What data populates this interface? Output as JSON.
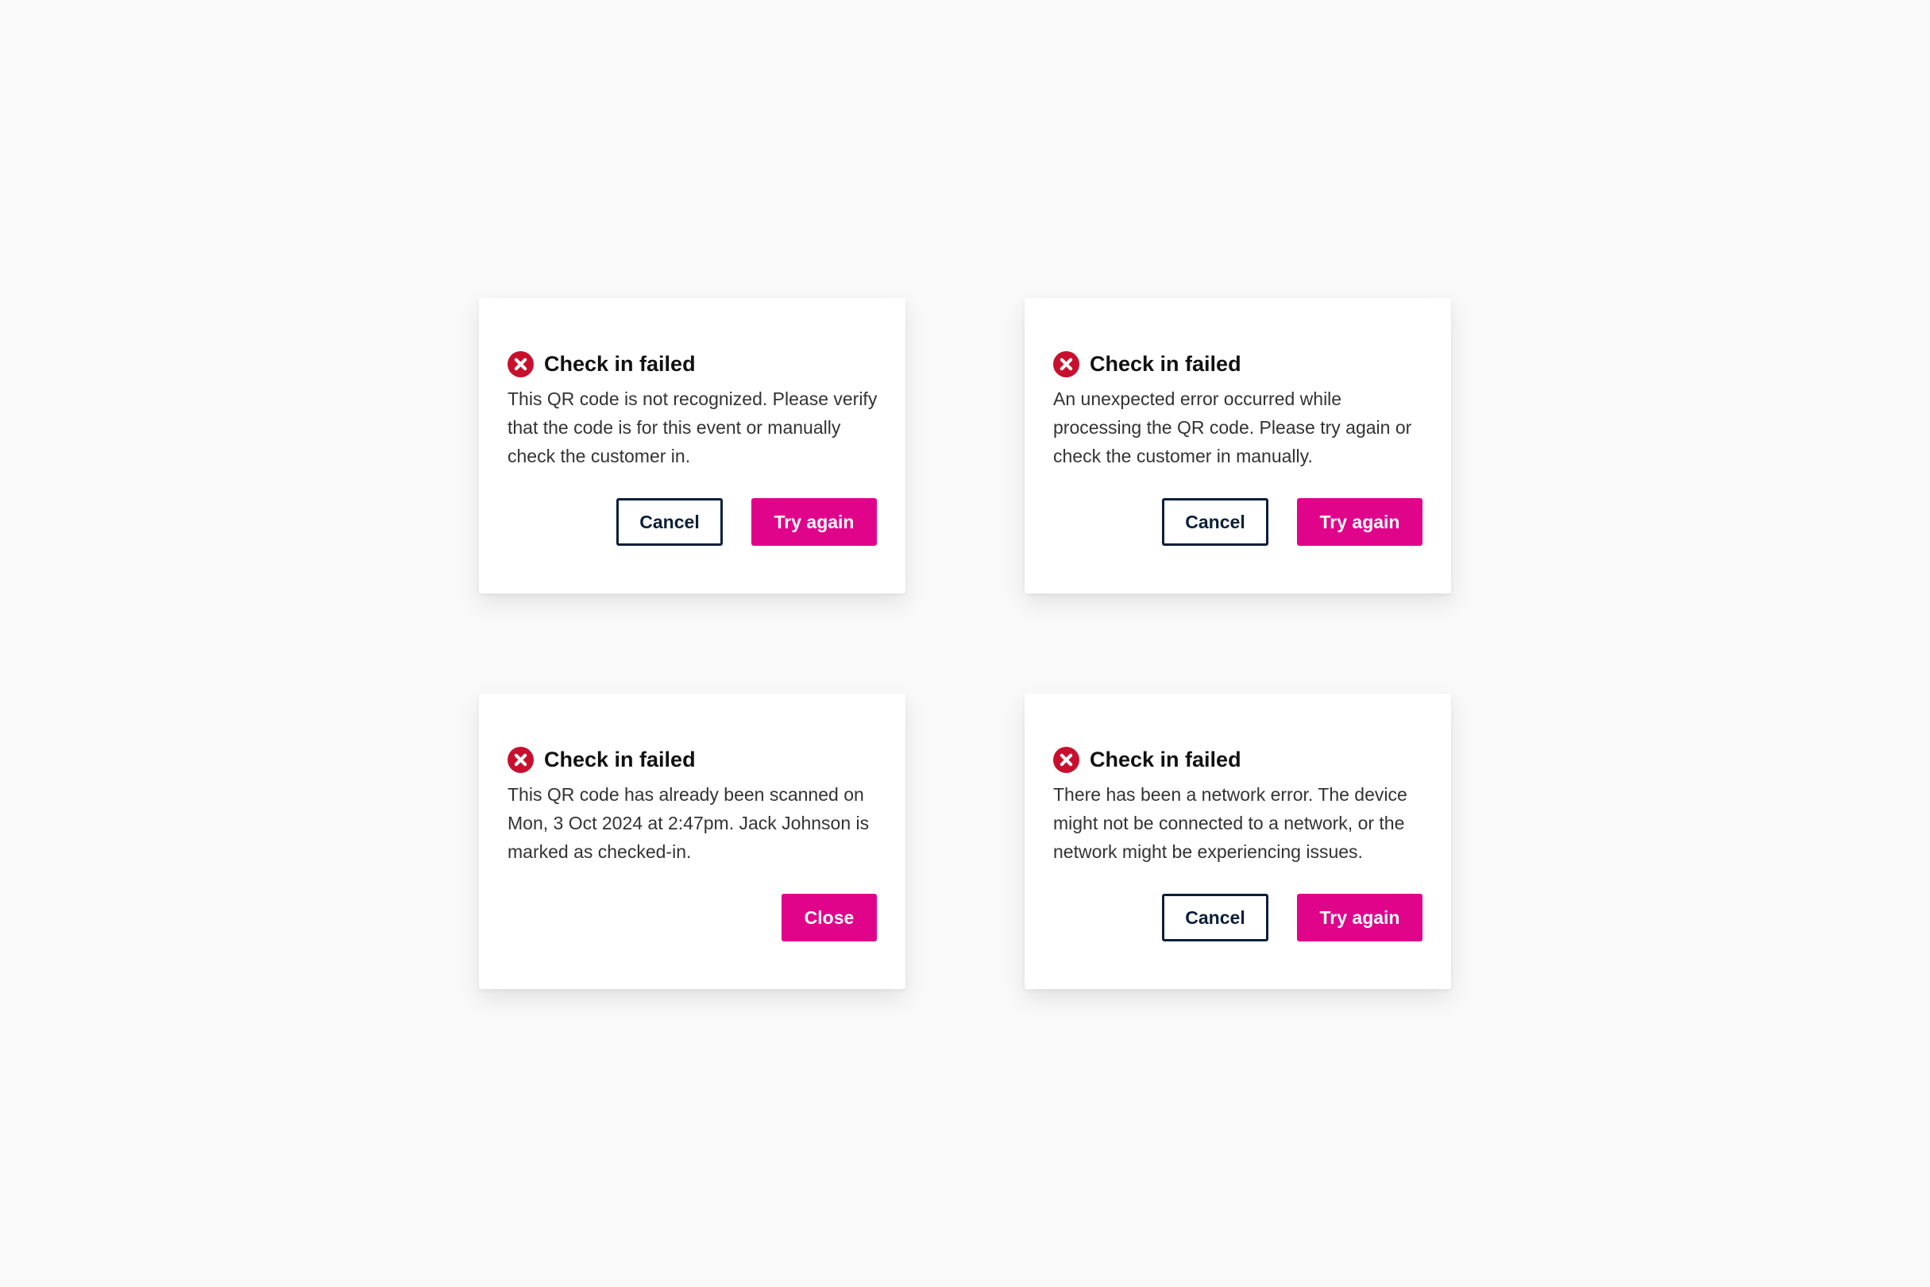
{
  "colors": {
    "background": "#f9f9f9",
    "error_icon": "#c8102e",
    "primary_button": "#e0048b",
    "secondary_border": "#0b1f3a"
  },
  "dialogs": [
    {
      "icon": "error-circle-x-icon",
      "title": "Check in failed",
      "message": "This QR code is not recognized. Please verify that the code is for this event or manually check the customer in.",
      "secondary_label": "Cancel",
      "primary_label": "Try again"
    },
    {
      "icon": "error-circle-x-icon",
      "title": "Check in failed",
      "message": "An unexpected error occurred while processing the QR code. Please try again or check the customer in manually.",
      "secondary_label": "Cancel",
      "primary_label": "Try again"
    },
    {
      "icon": "error-circle-x-icon",
      "title": "Check in failed",
      "message": "This QR code has already been scanned on Mon, 3 Oct 2024 at 2:47pm. Jack Johnson is marked as checked-in.",
      "primary_label": "Close"
    },
    {
      "icon": "error-circle-x-icon",
      "title": "Check in failed",
      "message": "There has been a network error. The device might not be connected to a network, or the network might be experiencing issues.",
      "secondary_label": "Cancel",
      "primary_label": "Try again"
    }
  ]
}
